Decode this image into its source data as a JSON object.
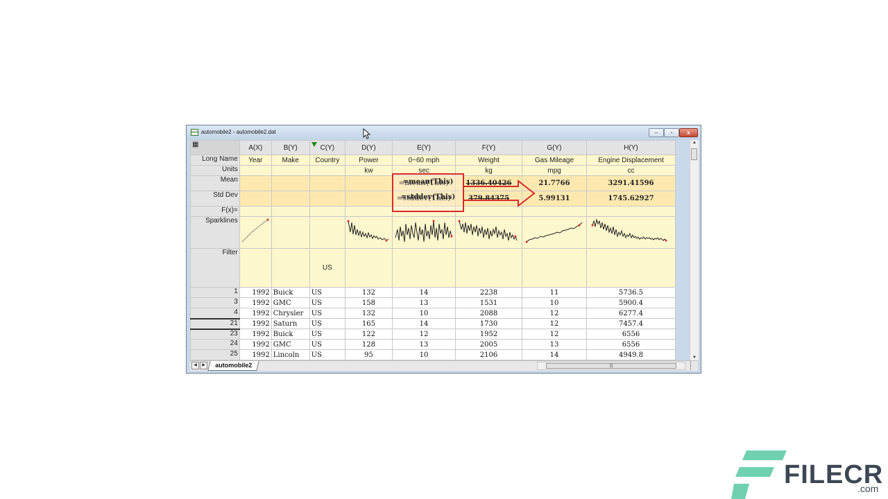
{
  "window": {
    "title": "automobile2 - automobile2.dat",
    "controls": [
      "–",
      "▫",
      "x"
    ]
  },
  "columns": [
    {
      "header": "A(X)",
      "long_name": "Year",
      "units": "",
      "mean": "",
      "std_dev": "",
      "filter": ""
    },
    {
      "header": "B(Y)",
      "long_name": "Make",
      "units": "",
      "mean": "",
      "std_dev": "",
      "filter": ""
    },
    {
      "header": "C(Y)",
      "long_name": "Country",
      "units": "",
      "mean": "",
      "std_dev": "",
      "filter": "US"
    },
    {
      "header": "D(Y)",
      "long_name": "Power",
      "units": "kw",
      "mean": "",
      "std_dev": "",
      "filter": ""
    },
    {
      "header": "E(Y)",
      "long_name": "0~60 mph",
      "units": "sec",
      "mean": "=mean(This)",
      "std_dev": "=stddev(This)",
      "filter": ""
    },
    {
      "header": "F(Y)",
      "long_name": "Weight",
      "units": "kg",
      "mean": "1336.40426",
      "std_dev": "379.84375",
      "filter": ""
    },
    {
      "header": "G(Y)",
      "long_name": "Gas Mileage",
      "units": "mpg",
      "mean": "21.7766",
      "std_dev": "5.99131",
      "filter": ""
    },
    {
      "header": "H(Y)",
      "long_name": "Engine Displacement",
      "units": "cc",
      "mean": "3291.41596",
      "std_dev": "1745.62927",
      "filter": ""
    }
  ],
  "row_labels": {
    "long_name": "Long Name",
    "units": "Units",
    "mean": "Mean",
    "std_dev": "Std Dev",
    "fx": "F(x)=",
    "sparklines": "Sparklines",
    "filter": "Filter"
  },
  "rows": [
    {
      "row": "1",
      "cells": [
        "1992",
        "Buick",
        "US",
        "132",
        "14",
        "2238",
        "11",
        "5736.5"
      ]
    },
    {
      "row": "3",
      "cells": [
        "1992",
        "GMC",
        "US",
        "158",
        "13",
        "1531",
        "10",
        "5900.4"
      ]
    },
    {
      "row": "4",
      "cells": [
        "1992",
        "Chrysler",
        "US",
        "132",
        "10",
        "2088",
        "12",
        "6277.4"
      ]
    },
    {
      "row": "21",
      "cells": [
        "1992",
        "Saturn",
        "US",
        "165",
        "14",
        "1730",
        "12",
        "7457.4"
      ]
    },
    {
      "row": "23",
      "cells": [
        "1992",
        "Buick",
        "US",
        "122",
        "12",
        "1952",
        "12",
        "6556"
      ]
    },
    {
      "row": "24",
      "cells": [
        "1992",
        "GMC",
        "US",
        "128",
        "13",
        "2005",
        "13",
        "6556"
      ]
    },
    {
      "row": "25",
      "cells": [
        "1992",
        "Lincoln",
        "US",
        "95",
        "10",
        "2106",
        "14",
        "4949.8"
      ]
    }
  ],
  "callout": {
    "mean_formula": "=mean(This)",
    "std_formula": "=stddev(This)"
  },
  "sheet_tab": "automobile2",
  "watermark": {
    "brand": "FILECR",
    "suffix": ".com"
  },
  "colors": {
    "meta_bg": "#fdf7cd",
    "stat_bg": "#fde9b0",
    "callout": "#d82a2a",
    "header_bg": "#e3e3e3"
  }
}
